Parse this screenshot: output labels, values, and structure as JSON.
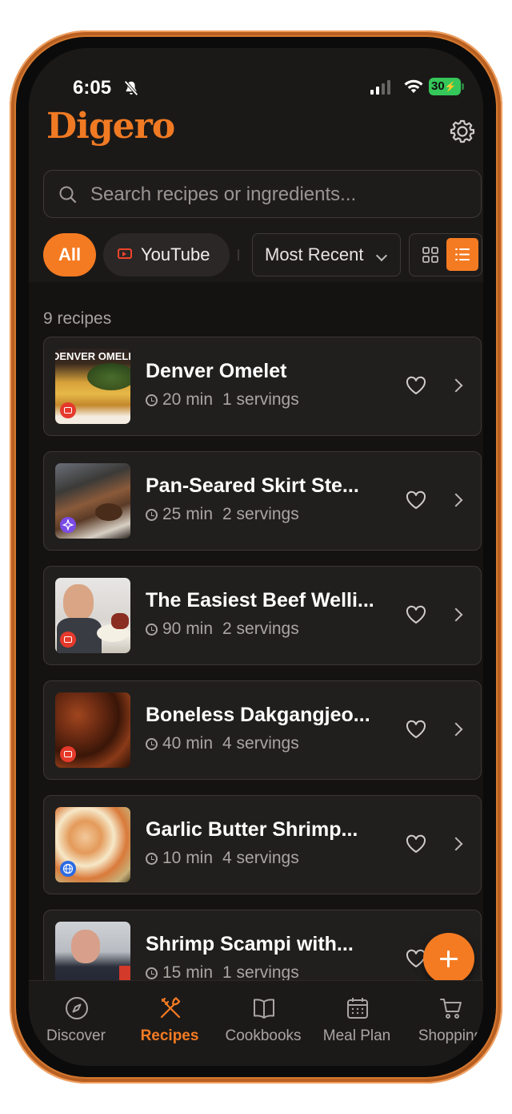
{
  "status": {
    "time": "6:05",
    "battery": "30"
  },
  "app": {
    "name": "Digero"
  },
  "search": {
    "placeholder": "Search recipes or ingredients..."
  },
  "filters": {
    "all": "All",
    "youtube": "YouTube"
  },
  "sort": {
    "selected": "Most Recent"
  },
  "recipe_count": "9 recipes",
  "recipes": [
    {
      "title": "Denver Omelet",
      "time": "20 min",
      "servings": "1 servings",
      "source": "youtube",
      "thumb_text": "DENVER OMELE"
    },
    {
      "title": "Pan-Seared Skirt Ste...",
      "time": "25 min",
      "servings": "2 servings",
      "source": "ai"
    },
    {
      "title": "The Easiest Beef Welli...",
      "time": "90 min",
      "servings": "2 servings",
      "source": "youtube"
    },
    {
      "title": "Boneless Dakgangjeo...",
      "time": "40 min",
      "servings": "4 servings",
      "source": "youtube"
    },
    {
      "title": "Garlic Butter Shrimp...",
      "time": "10 min",
      "servings": "4 servings",
      "source": "web"
    },
    {
      "title": "Shrimp Scampi with...",
      "time": "15 min",
      "servings": "1 servings",
      "source": "youtube"
    }
  ],
  "tabs": [
    {
      "label": "Discover",
      "icon": "compass-icon"
    },
    {
      "label": "Recipes",
      "icon": "utensils-icon"
    },
    {
      "label": "Cookbooks",
      "icon": "book-icon"
    },
    {
      "label": "Meal Plan",
      "icon": "calendar-icon"
    },
    {
      "label": "Shopping",
      "icon": "cart-icon"
    }
  ],
  "colors": {
    "accent": "#f57b22",
    "background": "#151312",
    "card": "#211f1e"
  }
}
